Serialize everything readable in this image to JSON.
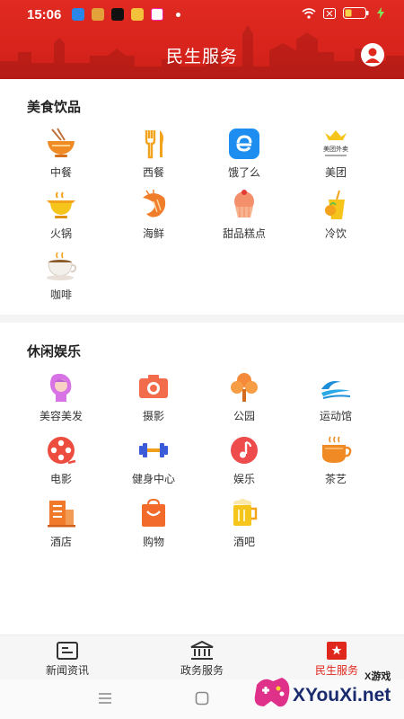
{
  "status_bar": {
    "time": "15:06"
  },
  "header": {
    "title": "民生服务"
  },
  "sections": [
    {
      "title": "美食饮品",
      "items": [
        {
          "label": "中餐",
          "icon": "noodle-bowl-icon"
        },
        {
          "label": "西餐",
          "icon": "fork-knife-icon"
        },
        {
          "label": "饿了么",
          "icon": "eleme-icon"
        },
        {
          "label": "美团",
          "icon": "meituan-icon"
        },
        {
          "label": "火锅",
          "icon": "hotpot-icon"
        },
        {
          "label": "海鲜",
          "icon": "shrimp-icon"
        },
        {
          "label": "甜品糕点",
          "icon": "cake-icon"
        },
        {
          "label": "冷饮",
          "icon": "cold-drink-icon"
        },
        {
          "label": "咖啡",
          "icon": "coffee-icon"
        }
      ]
    },
    {
      "title": "休闲娱乐",
      "items": [
        {
          "label": "美容美发",
          "icon": "beauty-icon"
        },
        {
          "label": "摄影",
          "icon": "camera-icon"
        },
        {
          "label": "公园",
          "icon": "tree-icon"
        },
        {
          "label": "运动馆",
          "icon": "wave-icon"
        },
        {
          "label": "电影",
          "icon": "film-reel-icon"
        },
        {
          "label": "健身中心",
          "icon": "dumbbell-icon"
        },
        {
          "label": "娱乐",
          "icon": "music-icon"
        },
        {
          "label": "茶艺",
          "icon": "tea-icon"
        },
        {
          "label": "酒店",
          "icon": "hotel-icon"
        },
        {
          "label": "购物",
          "icon": "shopping-bag-icon"
        },
        {
          "label": "酒吧",
          "icon": "beer-icon"
        }
      ]
    }
  ],
  "meituan_icon_text": "美团外卖",
  "bottom_nav": [
    {
      "label": "新闻资讯",
      "icon": "news-icon",
      "active": false
    },
    {
      "label": "政务服务",
      "icon": "government-icon",
      "active": false
    },
    {
      "label": "民生服务",
      "icon": "people-service-icon",
      "active": true
    }
  ],
  "watermark": {
    "text": "XYouXi.net",
    "sub": "X游戏"
  },
  "colors": {
    "brand_red": "#e0271d",
    "orange": "#f08a24"
  }
}
